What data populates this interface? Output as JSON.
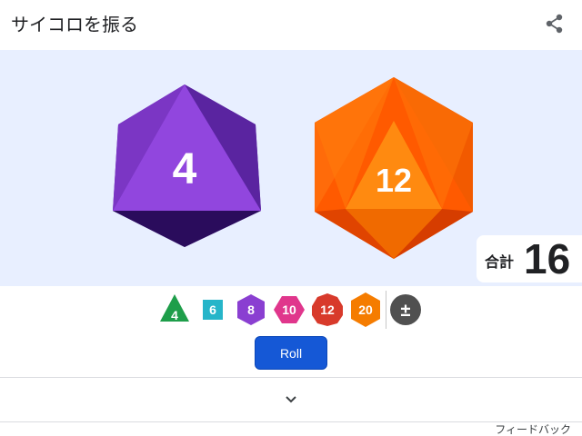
{
  "header": {
    "title": "サイコロを振る",
    "share_icon": "share-icon"
  },
  "dice": [
    {
      "type": "d8",
      "value": "4",
      "color": "#8a3fd1"
    },
    {
      "type": "d20",
      "value": "12",
      "color": "#f57c00"
    }
  ],
  "total": {
    "label": "合計",
    "value": "16"
  },
  "dice_selector": [
    {
      "type": "d4",
      "label": "4",
      "color": "#1e9e4a"
    },
    {
      "type": "d6",
      "label": "6",
      "color": "#26b5c9"
    },
    {
      "type": "d8",
      "label": "8",
      "color": "#8a3fd1"
    },
    {
      "type": "d10",
      "label": "10",
      "color": "#e0368c"
    },
    {
      "type": "d12",
      "label": "12",
      "color": "#d83a2b"
    },
    {
      "type": "d20",
      "label": "20",
      "color": "#f57c00"
    },
    {
      "type": "modifier",
      "label": "±",
      "color": "#505050"
    }
  ],
  "roll_button": {
    "label": "Roll",
    "color": "#1558d6"
  },
  "expand_icon": "chevron-down-icon",
  "feedback": "フィードバック",
  "colors": {
    "stage_background": "#e8efff"
  }
}
